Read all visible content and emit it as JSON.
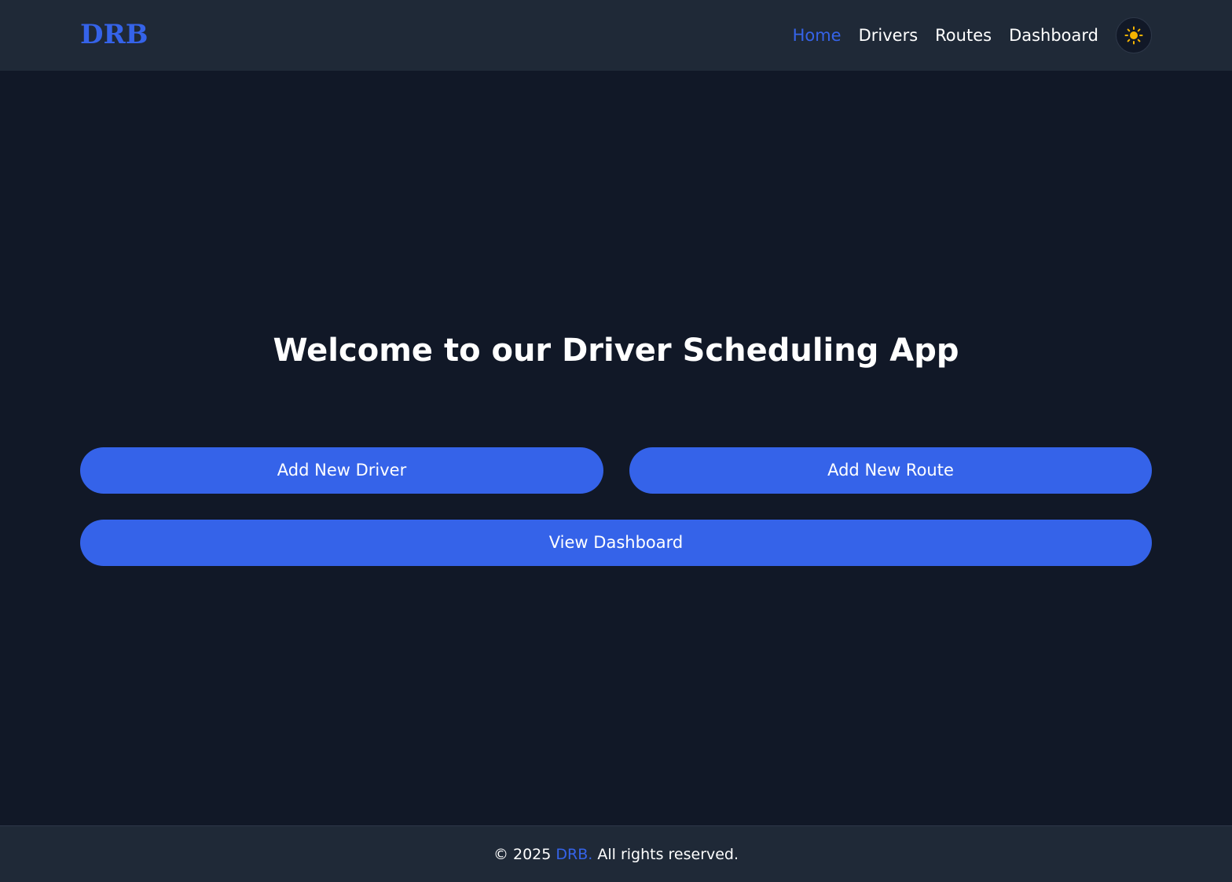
{
  "colors": {
    "accent": "#3563e9",
    "background": "#111827",
    "surface": "#1f2937",
    "text": "#ffffff",
    "sun_icon": "#f5b400"
  },
  "header": {
    "brand": "DRB",
    "nav": [
      {
        "label": "Home",
        "active": true
      },
      {
        "label": "Drivers",
        "active": false
      },
      {
        "label": "Routes",
        "active": false
      },
      {
        "label": "Dashboard",
        "active": false
      }
    ],
    "theme_toggle_icon": "sun-icon"
  },
  "main": {
    "title": "Welcome to our Driver Scheduling App",
    "buttons": {
      "add_driver": "Add New Driver",
      "add_route": "Add New Route",
      "view_dashboard": "View Dashboard"
    }
  },
  "footer": {
    "prefix": "© 2025",
    "brand": "DRB.",
    "suffix": "All rights reserved."
  }
}
